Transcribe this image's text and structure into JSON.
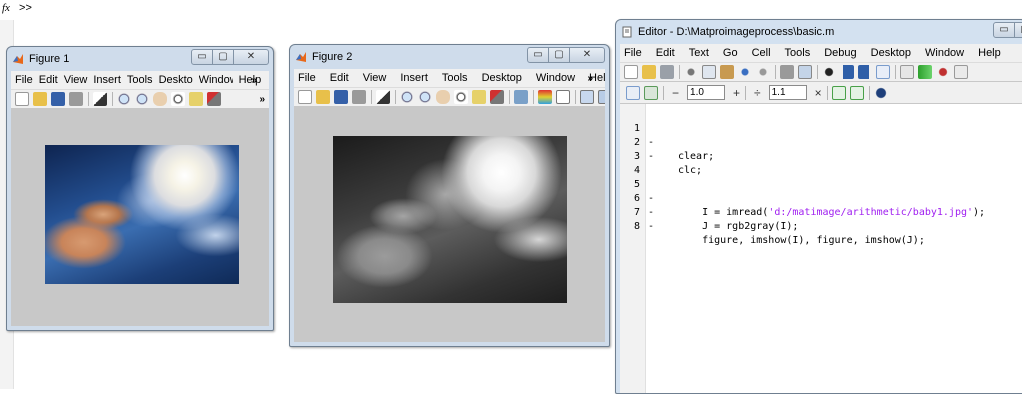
{
  "command_window": {
    "fx": "fx",
    "prompt": ">>"
  },
  "figure1": {
    "title": "Figure 1",
    "buttons": {
      "minimize": "▭",
      "maximize": "▢",
      "close": "✕"
    },
    "menu": [
      "File",
      "Edit",
      "View",
      "Insert",
      "Tools",
      "Desktop",
      "Window",
      "Help"
    ],
    "menu_overflow": "»",
    "toolbar_overflow": "»"
  },
  "figure2": {
    "title": "Figure 2",
    "buttons": {
      "minimize": "▭",
      "maximize": "▢",
      "close": "✕"
    },
    "menu": [
      "File",
      "Edit",
      "View",
      "Insert",
      "Tools",
      "Desktop",
      "Window",
      "Help"
    ],
    "menu_overflow": "»",
    "toolbar_overflow": "»"
  },
  "editor": {
    "title": "Editor - D:\\Matproimageprocess\\basic.m",
    "buttons": {
      "minimize": "▭",
      "maximize": "▢"
    },
    "menu": [
      "File",
      "Edit",
      "Text",
      "Go",
      "Cell",
      "Tools",
      "Debug",
      "Desktop",
      "Window",
      "Help"
    ],
    "cell_toolbar": {
      "minus": "−",
      "value1": "1.0",
      "plus": "+",
      "divide": "÷",
      "value2": "1.1",
      "times": "×"
    },
    "lines": [
      {
        "n": "1",
        "dash": "-",
        "code": "clear;"
      },
      {
        "n": "2",
        "dash": "-",
        "code": "clc;"
      },
      {
        "n": "3",
        "dash": "",
        "code": ""
      },
      {
        "n": "4",
        "dash": "",
        "code": ""
      },
      {
        "n": "5",
        "dash": "-",
        "code_pre": "    I = imread(",
        "code_str": "'d:/matimage/arithmetic/baby1.jpg'",
        "code_post": ");"
      },
      {
        "n": "6",
        "dash": "-",
        "code": "    J = rgb2gray(I);"
      },
      {
        "n": "7",
        "dash": "-",
        "code": "    figure, imshow(I), figure, imshow(J);"
      },
      {
        "n": "8",
        "dash": "",
        "code": ""
      }
    ]
  },
  "colors": {
    "string": "#a020f0",
    "titlebar": "#c9d9ea",
    "canvas": "#c8c8c8"
  }
}
